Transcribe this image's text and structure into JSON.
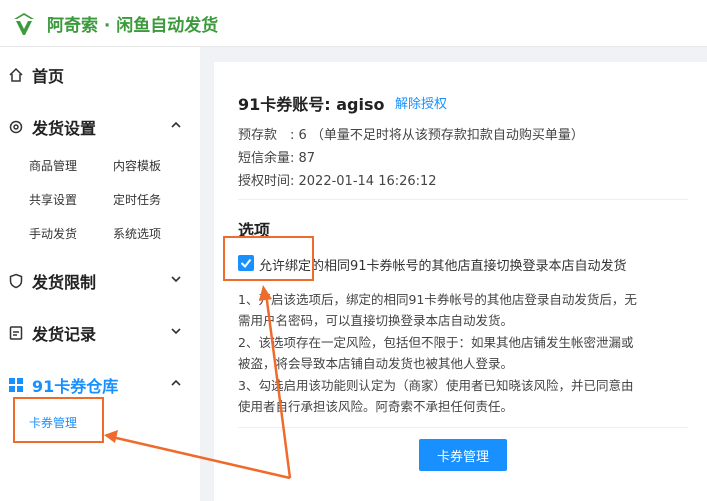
{
  "app": {
    "title": "阿奇索 · 闲鱼自动发货"
  },
  "sidebar": {
    "home": "首页",
    "groups": [
      {
        "label": "发货设置",
        "items": [
          "商品管理",
          "内容模板",
          "共享设置",
          "定时任务",
          "手动发货",
          "系统选项"
        ]
      },
      {
        "label": "发货限制"
      },
      {
        "label": "发货记录"
      },
      {
        "label": "91卡券仓库",
        "items": [
          "卡券管理"
        ]
      }
    ]
  },
  "panel": {
    "title": "91卡券账号: agiso",
    "revoke": "解除授权",
    "prepaid": "预存款　: 6 （单量不足时将从该预存款扣款自动购买单量）",
    "sms": "短信余量: 87",
    "auth_time": "授权时间: 2022-01-14 16:26:12",
    "options_title": "选项",
    "checkbox_label": "允许绑定的相同91卡券帐号的其他店直接切换登录本店自动发货",
    "notes": [
      "1、开启该选项后，绑定的相同91卡券帐号的其他店登录自动发货后，无",
      "需用户名密码，可以直接切换登录本店自动发货。",
      "2、该选项存在一定风险，包括但不限于：如果其他店铺发生帐密泄漏或",
      "被盗，将会导致本店铺自动发货也被其他人登录。",
      "3、勾选启用该功能则认定为（商家）使用者已知晓该风险，并已同意由",
      "使用者自行承担该风险。阿奇索不承担任何责任。"
    ],
    "button": "卡券管理"
  },
  "colors": {
    "brand_green": "#3c9a3c",
    "accent_blue": "#1890ff",
    "highlight_orange": "#ef6b2b"
  }
}
